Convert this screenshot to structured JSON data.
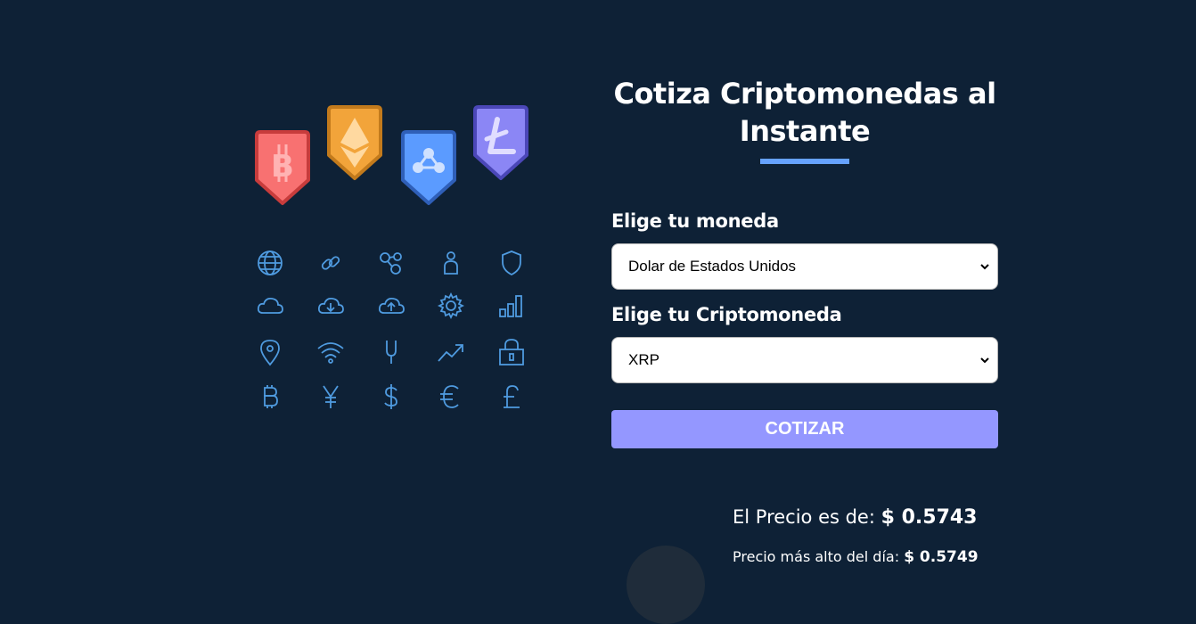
{
  "header": {
    "title": "Cotiza Criptomonedas al Instante"
  },
  "form": {
    "currency_label": "Elige tu moneda",
    "currency_value": "Dolar de Estados Unidos",
    "crypto_label": "Elige tu Criptomoneda",
    "crypto_value": "XRP",
    "submit_label": "COTIZAR"
  },
  "result": {
    "price_label": "El Precio es de:",
    "price_value": "$ 0.5743",
    "high_label": "Precio más alto del día:",
    "high_value": "$ 0.5749"
  },
  "illustration": {
    "badges": [
      "bitcoin-icon",
      "ethereum-icon",
      "ripple-icon",
      "litecoin-icon"
    ],
    "icons": [
      [
        "globe-icon",
        "link-icon",
        "nodes-icon",
        "user-icon",
        "shield-icon"
      ],
      [
        "cloud-icon",
        "cloud-download-icon",
        "cloud-upload-icon",
        "gear-icon",
        "bar-chart-icon"
      ],
      [
        "location-pin-icon",
        "wifi-icon",
        "plug-icon",
        "trend-up-icon",
        "lock-icon"
      ],
      [
        "bitcoin-symbol-icon",
        "yen-icon",
        "dollar-icon",
        "euro-icon",
        "pound-icon"
      ]
    ]
  },
  "colors": {
    "background": "#0e2136",
    "accent": "#66a2fe",
    "button": "#9497ff",
    "icon_stroke": "#4f9be0",
    "bitcoin_badge": "#f87171",
    "ethereum_badge": "#f2a43a",
    "ripple_badge": "#5b9bff",
    "litecoin_badge": "#8b86f5"
  }
}
